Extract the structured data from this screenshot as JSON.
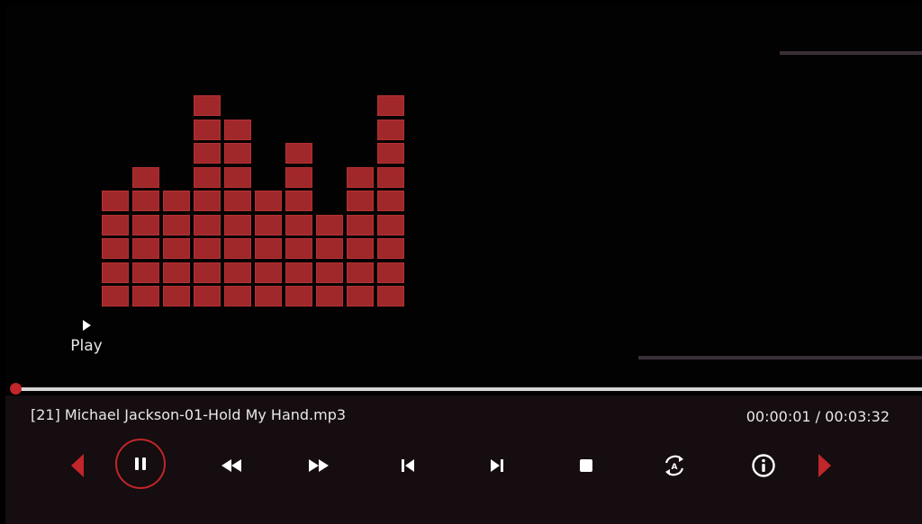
{
  "visualizer": {
    "columns": [
      5,
      6,
      5,
      9,
      8,
      5,
      7,
      4,
      6,
      9
    ],
    "color": "#a0282a"
  },
  "status": {
    "icon": "play-icon",
    "label": "Play"
  },
  "playback": {
    "progress_fraction": 0.005,
    "track_title": "[21] Michael Jackson-01-Hold My Hand.mp3",
    "elapsed": "00:00:01",
    "separator": "/",
    "duration": "00:03:32",
    "time_display": "00:00:01 / 00:03:32"
  },
  "controls": [
    {
      "name": "prev-page-arrow",
      "icon": "triangle-left-icon"
    },
    {
      "name": "pause-button",
      "icon": "pause-icon"
    },
    {
      "name": "rewind-button",
      "icon": "rewind-icon"
    },
    {
      "name": "fast-forward-button",
      "icon": "fast-forward-icon"
    },
    {
      "name": "previous-track-button",
      "icon": "skip-previous-icon"
    },
    {
      "name": "next-track-button",
      "icon": "skip-next-icon"
    },
    {
      "name": "stop-button",
      "icon": "stop-icon"
    },
    {
      "name": "repeat-mode-button",
      "icon": "repeat-a-icon"
    },
    {
      "name": "info-button",
      "icon": "info-icon"
    },
    {
      "name": "next-page-arrow",
      "icon": "triangle-right-icon"
    }
  ],
  "colors": {
    "accent": "#c0262a",
    "background": "#020202",
    "panel": "#150d0f",
    "track": "#d6d6d6"
  }
}
